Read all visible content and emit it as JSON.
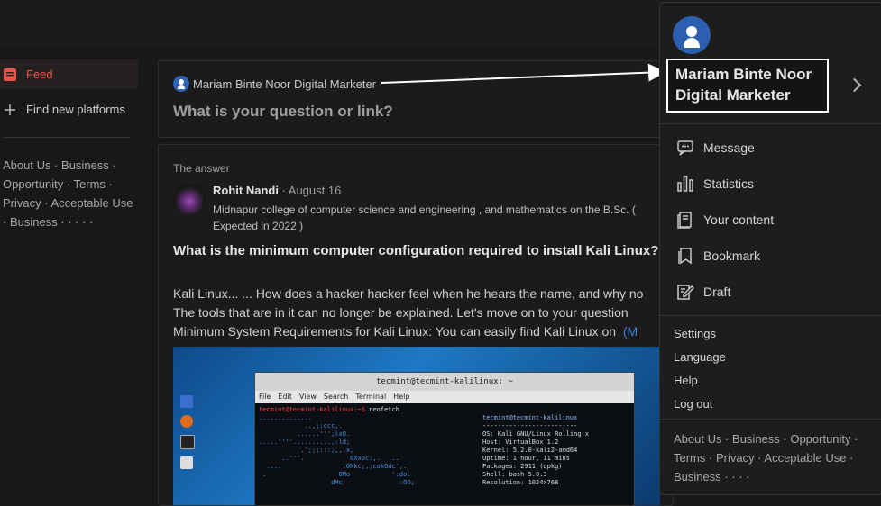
{
  "sidebar": {
    "feed": "Feed",
    "find": "Find new platforms",
    "footer": "About Us · Business · Opportunity · Terms · Privacy · Acceptable Use · Business · · · · ·"
  },
  "ask": {
    "user": "Mariam Binte Noor Digital Marketer",
    "placeholder": "What is your question or link?"
  },
  "answer": {
    "label": "The answer",
    "author": "Rohit Nandi",
    "date": " · August 16",
    "bio": "Midnapur college of computer science and engineering , and mathematics on the B.Sc. ( Expected in 2022 )",
    "question": "What is the minimum computer configuration required to install Kali Linux?",
    "line1": "Kali Linux... ... How does a hacker hacker feel when he hears the name, and why no",
    "line2": "The tools that are in it can no longer be explained. Let's move on to your question",
    "line3": "Minimum System Requirements for Kali Linux: You can easily find Kali Linux on",
    "more": "(M"
  },
  "screenshot": {
    "title": "tecmint@tecmint-kalilinux: ~",
    "menu": [
      "File",
      "Edit",
      "View",
      "Search",
      "Terminal",
      "Help"
    ],
    "prompt": "tecmint@tecmint-kalilinux:~$",
    "command": " neofetch",
    "host": "tecmint@tecmint-kalilinux",
    "sep": "-------------------------",
    "info": [
      "OS: Kali GNU/Linux Rolling x",
      "Host: VirtualBox 1.2",
      "Kernel: 5.2.0-kali2-amd64",
      "Uptime: 1 hour, 11 mins",
      "Packages: 2911 (dpkg)",
      "Shell: bash 5.0.3",
      "Resolution: 1024x768"
    ],
    "logo": [
      "..............",
      "            ..,;:ccc,.",
      "          ......''';lxO.",
      ".....''''..........,:ld;",
      "           .';;;:::;,,.x,",
      "      ..'''.            0Xxoc:,.  ...",
      "  ....                ,ONkc;,;cokOdc',.",
      " .                   OMo           ':do.",
      "                   dMc               :OO;"
    ]
  },
  "menu": {
    "name_line1": "Mariam Binte Noor",
    "name_line2": "Digital Marketer",
    "items": [
      "Message",
      "Statistics",
      "Your content",
      "Bookmark",
      "Draft"
    ],
    "links": [
      "Settings",
      "Language",
      "Help",
      "Log out"
    ],
    "footer": "About Us · Business · Opportunity · Terms · Privacy · Acceptable Use · Business · · · ·"
  }
}
